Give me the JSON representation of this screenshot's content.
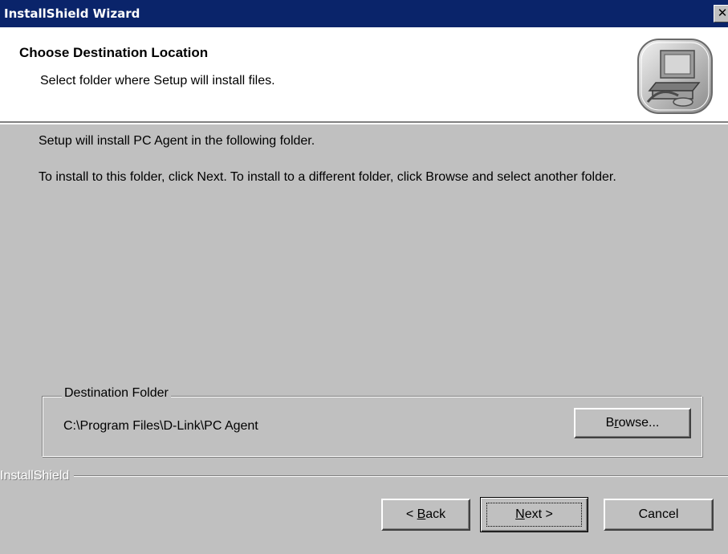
{
  "window": {
    "title": "InstallShield Wizard",
    "close_glyph": "✕"
  },
  "header": {
    "title": "Choose Destination Location",
    "subtitle": "Select folder where Setup will install files.",
    "logo_icon": "installshield-computer-icon"
  },
  "body": {
    "line1": "Setup will install PC Agent in the following folder.",
    "line2": "To install to this folder, click Next. To install to a different folder, click Browse and select another folder."
  },
  "destination": {
    "group_label": "Destination Folder",
    "path": "C:\\Program Files\\D-Link\\PC Agent",
    "browse": {
      "pre": "B",
      "key": "r",
      "post": "owse..."
    }
  },
  "branding": {
    "text": "InstallShield"
  },
  "buttons": {
    "back": {
      "pre": "< ",
      "key": "B",
      "post": "ack"
    },
    "next": {
      "pre": "",
      "key": "N",
      "post": "ext >"
    },
    "cancel": "Cancel"
  },
  "colors": {
    "titlebar": "#0a246a",
    "face": "#c0c0c0",
    "header_bg": "#ffffff"
  }
}
